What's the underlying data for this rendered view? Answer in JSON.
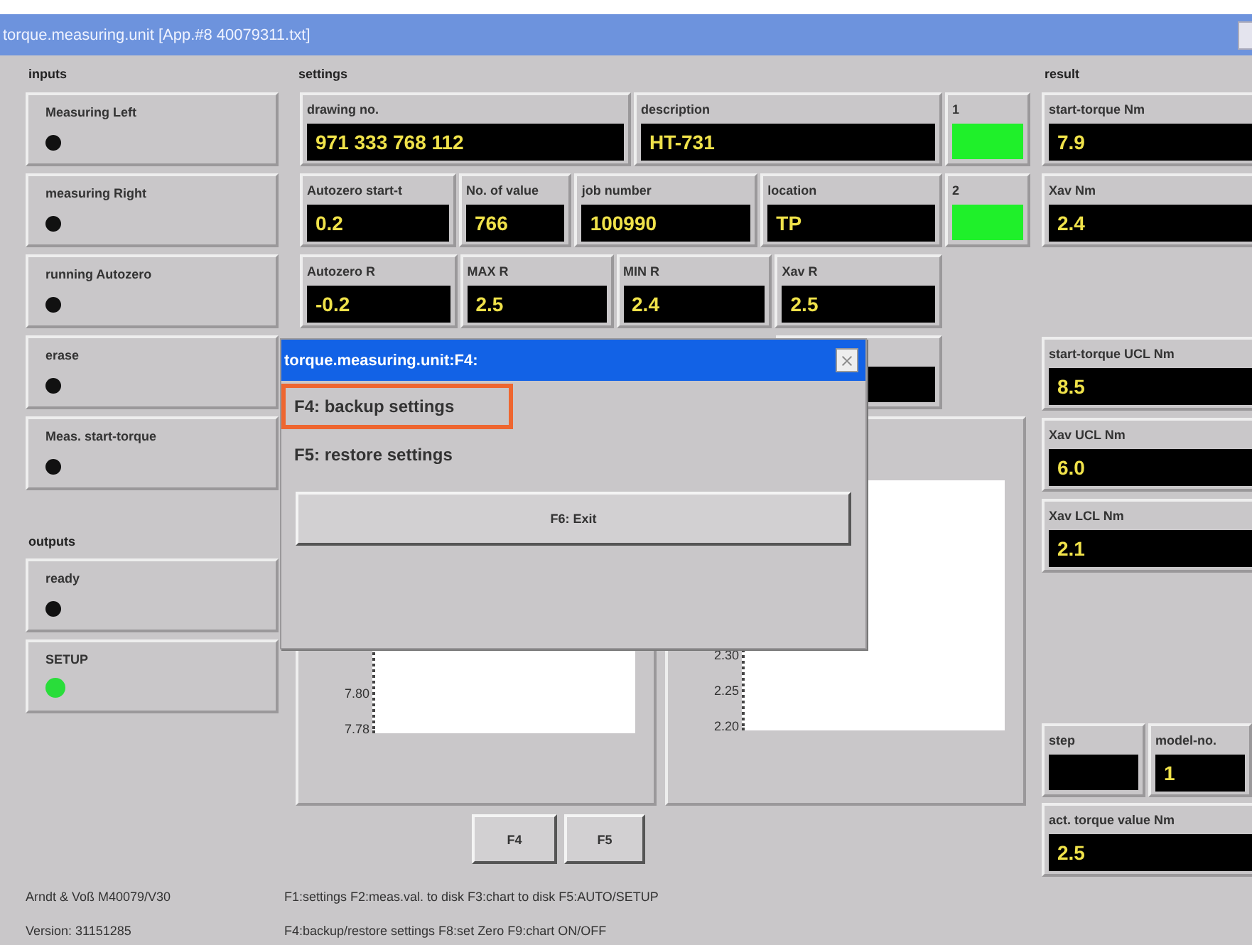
{
  "window": {
    "title": "torque.measuring.unit [App.#8 40079311.txt]"
  },
  "inputs": {
    "heading": "inputs",
    "items": [
      {
        "label": "Measuring Left",
        "lit": false
      },
      {
        "label": "measuring Right",
        "lit": false
      },
      {
        "label": "running Autozero",
        "lit": false
      },
      {
        "label": "erase",
        "lit": false
      },
      {
        "label": "Meas. start-torque",
        "lit": false
      }
    ]
  },
  "outputs": {
    "heading": "outputs",
    "items": [
      {
        "label": "ready",
        "lit": false
      },
      {
        "label": "SETUP",
        "lit": true
      }
    ]
  },
  "settings": {
    "heading": "settings",
    "rows": [
      [
        {
          "kind": "display",
          "label": "drawing no.",
          "value": "971 333 768 112"
        },
        {
          "kind": "display",
          "label": "description",
          "value": "HT-731"
        }
      ],
      [
        {
          "kind": "display",
          "label": "Autozero start-t",
          "value": "0.2"
        },
        {
          "kind": "display",
          "label": "No. of value",
          "value": "766"
        },
        {
          "kind": "display",
          "label": "job number",
          "value": "100990"
        },
        {
          "kind": "display",
          "label": "location",
          "value": "TP"
        }
      ],
      [
        {
          "kind": "display",
          "label": "Autozero R",
          "value": "-0.2"
        },
        {
          "kind": "display",
          "label": "MAX R",
          "value": "2.5"
        },
        {
          "kind": "display",
          "label": "MIN R",
          "value": "2.4"
        },
        {
          "kind": "display",
          "label": "Xav R",
          "value": "2.5"
        }
      ],
      [
        {
          "kind": "display"
        }
      ]
    ],
    "lamps": [
      {
        "label": "1",
        "on": true
      },
      {
        "label": "2",
        "on": true
      }
    ]
  },
  "charts": [
    {
      "y_ticks": [
        "7.80",
        "7.78"
      ]
    },
    {
      "y_ticks": [
        "2.30",
        "2.25",
        "2.20"
      ]
    }
  ],
  "function_keys": [
    "F4",
    "F5"
  ],
  "result": {
    "heading": "result",
    "items": [
      {
        "label": "start-torque Nm",
        "value": "7.9"
      },
      {
        "label": "Xav Nm",
        "value": "2.4"
      },
      {
        "label": "start-torque UCL Nm",
        "value": "8.5"
      },
      {
        "label": "Xav UCL Nm",
        "value": "6.0"
      },
      {
        "label": "Xav LCL Nm",
        "value": "2.1"
      }
    ],
    "counters": [
      {
        "label": "step"
      },
      {
        "label": "model-no.",
        "value": "1"
      }
    ],
    "actual": {
      "label": "act. torque value Nm",
      "value": "2.5"
    }
  },
  "footer": {
    "vendor": "Arndt & Voß M40079/V30",
    "version": "Version: 31151285",
    "help": [
      "F1:settings F2:meas.val. to disk F3:chart to disk F5:AUTO/SETUP",
      "F4:backup/restore settings F8:set Zero F9:chart ON/OFF"
    ]
  },
  "dialog": {
    "title": "torque.measuring.unit:F4:",
    "options": [
      {
        "label": "F4: backup settings",
        "highlighted": true
      },
      {
        "label": "F5: restore settings",
        "highlighted": false
      }
    ],
    "button": "F6: Exit"
  }
}
